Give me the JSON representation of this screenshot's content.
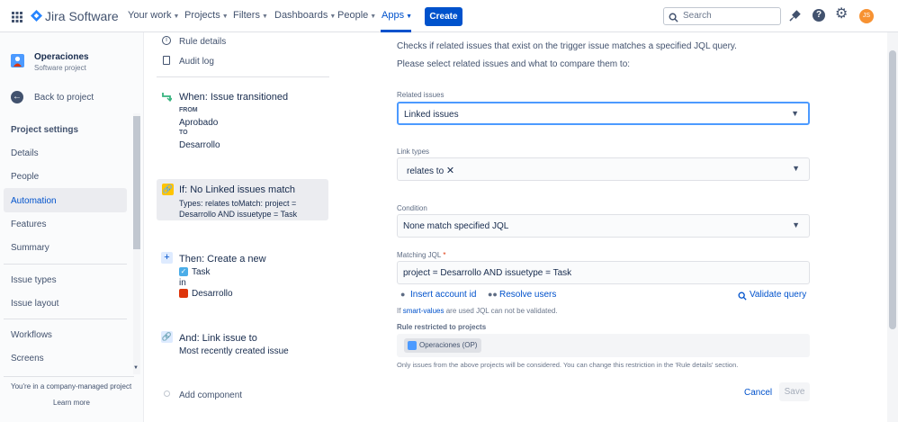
{
  "app": {
    "name": "Jira Software"
  },
  "nav": {
    "items": [
      {
        "label": "Your work"
      },
      {
        "label": "Projects"
      },
      {
        "label": "Filters"
      },
      {
        "label": "Dashboards"
      },
      {
        "label": "People"
      },
      {
        "label": "Apps"
      }
    ],
    "create_label": "Create",
    "search_placeholder": "Search",
    "avatar_initials": "JS"
  },
  "sidebar": {
    "project_name": "Operaciones",
    "project_type": "Software project",
    "back": "Back to project",
    "section": "Project settings",
    "items": [
      {
        "label": "Details"
      },
      {
        "label": "People"
      },
      {
        "label": "Automation"
      },
      {
        "label": "Features"
      },
      {
        "label": "Summary"
      },
      {
        "label": "Issue types"
      },
      {
        "label": "Issue layout"
      },
      {
        "label": "Workflows"
      },
      {
        "label": "Screens"
      }
    ],
    "footer_text": "You're in a company-managed project",
    "learn_more": "Learn more"
  },
  "rule": {
    "rule_details": "Rule details",
    "audit_log": "Audit log",
    "trigger": {
      "title": "When: Issue transitioned",
      "from_label": "FROM",
      "from_value": "Aprobado",
      "to_label": "TO",
      "to_value": "Desarrollo"
    },
    "condition": {
      "title": "If: No Linked issues match",
      "line1": "Types: relates toMatch: project =",
      "line2": "Desarrollo AND issuetype = Task"
    },
    "action1": {
      "title": "Then: Create a new",
      "issue_type": "Task",
      "in": "in",
      "project": "Desarrollo"
    },
    "action2": {
      "title": "And: Link issue to",
      "subtitle": "Most recently created issue"
    },
    "add_component": "Add component"
  },
  "form": {
    "intro1": "Checks if related issues that exist on the trigger issue matches a specified JQL query.",
    "intro2": "Please select related issues and what to compare them to:",
    "related_label": "Related issues",
    "related_value": "Linked issues",
    "link_types_label": "Link types",
    "link_type_value": "relates to",
    "condition_label": "Condition",
    "condition_value": "None match specified JQL",
    "jql_label": "Matching JQL",
    "required_mark": "*",
    "jql_value": "project = Desarrollo AND issuetype = Task",
    "insert_account": "Insert account id",
    "resolve_users": "Resolve users",
    "validate_query": "Validate query",
    "note_prefix": "If",
    "note_link": "smart-values",
    "note_suffix": "are used JQL can not be validated.",
    "restricted_label": "Rule restricted to projects",
    "restricted_project": "Operaciones (OP)",
    "restricted_note": "Only issues from the above projects will be considered. You can change this restriction in the 'Rule details' section.",
    "cancel": "Cancel",
    "save": "Save"
  },
  "colors": {
    "brand": "#0052cc",
    "accent_orange": "#f79232"
  }
}
